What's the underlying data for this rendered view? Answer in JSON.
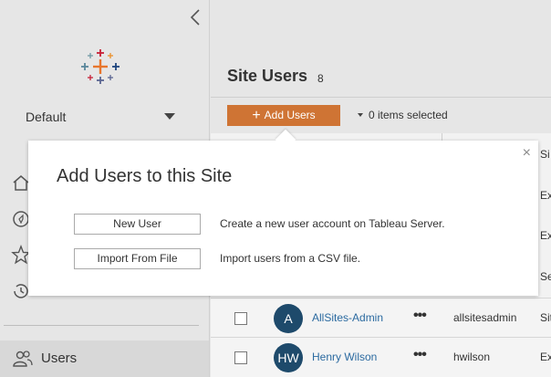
{
  "sidebar": {
    "site_name": "Default",
    "nav_users_label": "Users"
  },
  "main": {
    "page_title": "Site Users",
    "user_count": "8",
    "add_users_label": "Add Users",
    "selection_label": "0 items selected",
    "header_col_right": "Si",
    "partial_rows": [
      "Ex",
      "Ex",
      "Se"
    ],
    "rows": [
      {
        "initials": "A",
        "name": "AllSites-Admin",
        "login": "allsitesadmin",
        "role": "Sit"
      },
      {
        "initials": "HW",
        "name": "Henry Wilson",
        "login": "hwilson",
        "role": "Ex"
      }
    ]
  },
  "popover": {
    "title": "Add Users to this Site",
    "close_glyph": "×",
    "new_user_label": "New User",
    "new_user_desc": "Create a new user account on Tableau Server.",
    "import_label": "Import From File",
    "import_desc": "Import users from a CSV file."
  },
  "colors": {
    "accent": "#cf7434",
    "avatar": "#1e4a6b",
    "link": "#2b6aa0"
  }
}
